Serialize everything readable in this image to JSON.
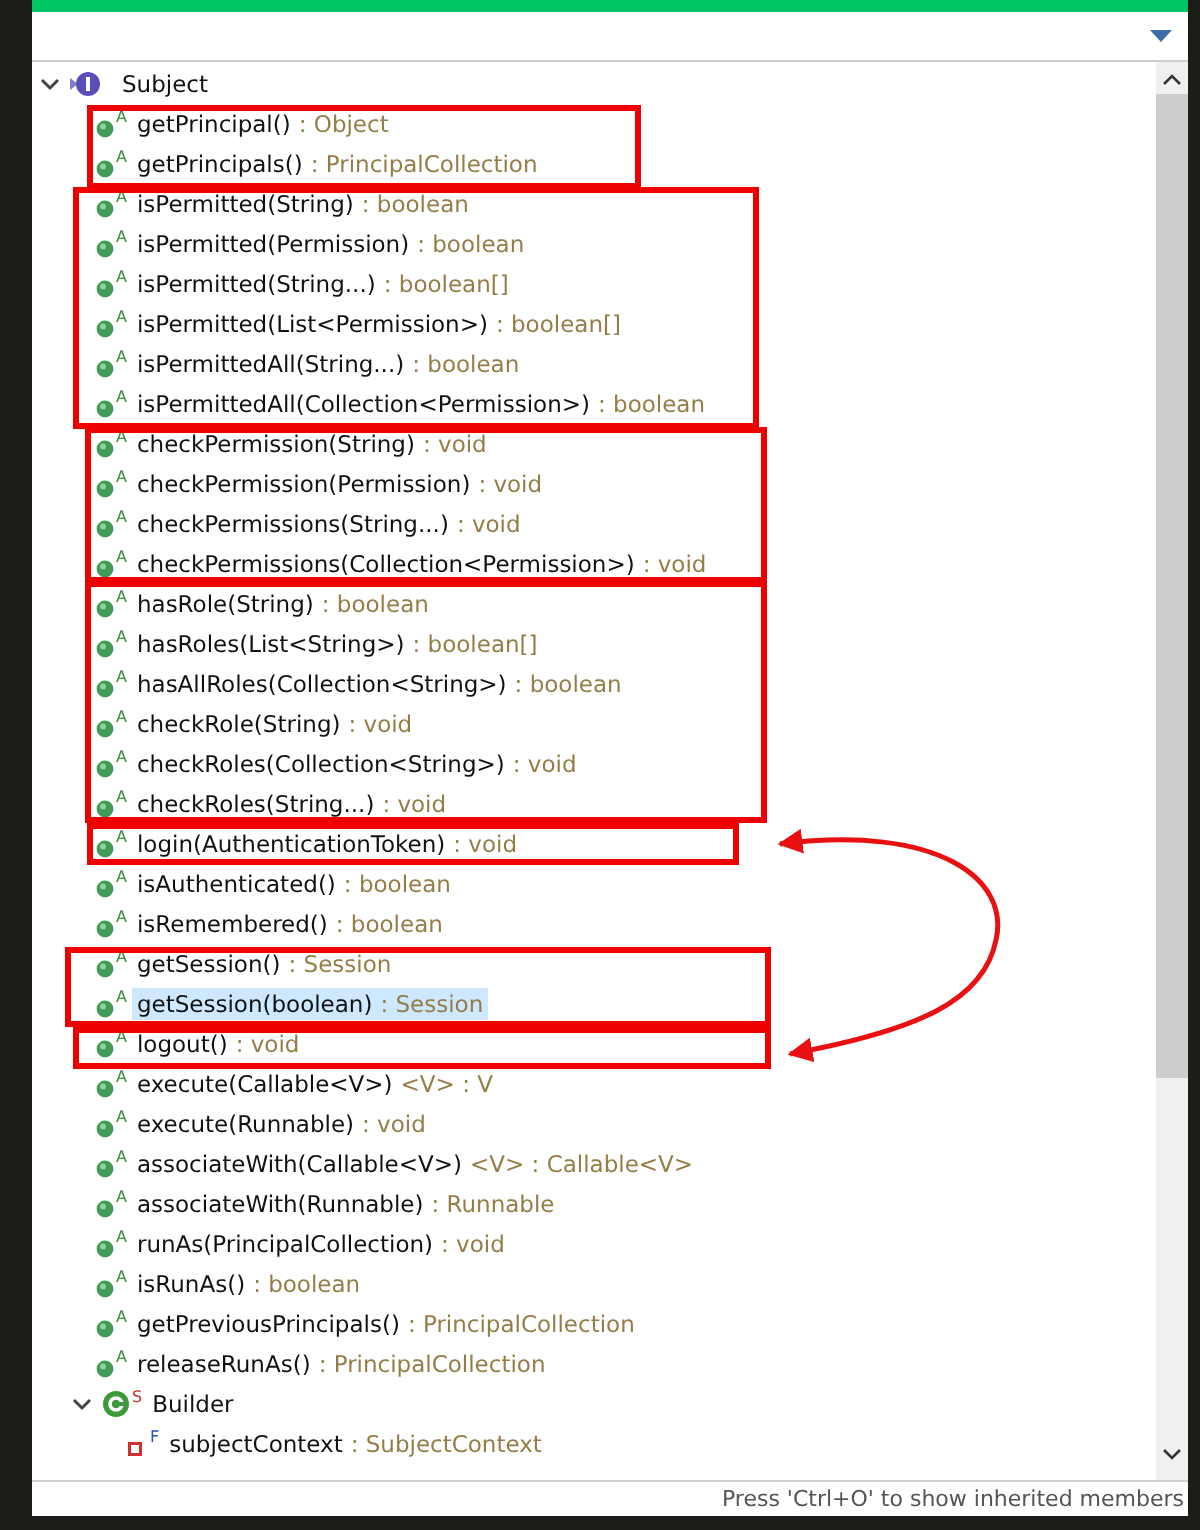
{
  "tree": [
    {
      "kind": "interface",
      "name": "Subject",
      "expanded": true,
      "children": [
        {
          "kind": "method",
          "modifier": "A",
          "name": "getPrincipal()",
          "detail": ": Object",
          "selected": false
        },
        {
          "kind": "method",
          "modifier": "A",
          "name": "getPrincipals()",
          "detail": ": PrincipalCollection",
          "selected": false
        },
        {
          "kind": "method",
          "modifier": "A",
          "name": "isPermitted(String)",
          "detail": ": boolean",
          "selected": false
        },
        {
          "kind": "method",
          "modifier": "A",
          "name": "isPermitted(Permission)",
          "detail": ": boolean",
          "selected": false
        },
        {
          "kind": "method",
          "modifier": "A",
          "name": "isPermitted(String...)",
          "detail": ": boolean[]",
          "selected": false
        },
        {
          "kind": "method",
          "modifier": "A",
          "name": "isPermitted(List<Permission>)",
          "detail": ": boolean[]",
          "selected": false
        },
        {
          "kind": "method",
          "modifier": "A",
          "name": "isPermittedAll(String...)",
          "detail": ": boolean",
          "selected": false
        },
        {
          "kind": "method",
          "modifier": "A",
          "name": "isPermittedAll(Collection<Permission>)",
          "detail": ": boolean",
          "selected": false
        },
        {
          "kind": "method",
          "modifier": "A",
          "name": "checkPermission(String)",
          "detail": ": void",
          "selected": false
        },
        {
          "kind": "method",
          "modifier": "A",
          "name": "checkPermission(Permission)",
          "detail": ": void",
          "selected": false
        },
        {
          "kind": "method",
          "modifier": "A",
          "name": "checkPermissions(String...)",
          "detail": ": void",
          "selected": false
        },
        {
          "kind": "method",
          "modifier": "A",
          "name": "checkPermissions(Collection<Permission>)",
          "detail": ": void",
          "selected": false
        },
        {
          "kind": "method",
          "modifier": "A",
          "name": "hasRole(String)",
          "detail": ": boolean",
          "selected": false
        },
        {
          "kind": "method",
          "modifier": "A",
          "name": "hasRoles(List<String>)",
          "detail": ": boolean[]",
          "selected": false
        },
        {
          "kind": "method",
          "modifier": "A",
          "name": "hasAllRoles(Collection<String>)",
          "detail": ": boolean",
          "selected": false
        },
        {
          "kind": "method",
          "modifier": "A",
          "name": "checkRole(String)",
          "detail": ": void",
          "selected": false
        },
        {
          "kind": "method",
          "modifier": "A",
          "name": "checkRoles(Collection<String>)",
          "detail": ": void",
          "selected": false
        },
        {
          "kind": "method",
          "modifier": "A",
          "name": "checkRoles(String...)",
          "detail": ": void",
          "selected": false
        },
        {
          "kind": "method",
          "modifier": "A",
          "name": "login(AuthenticationToken)",
          "detail": ": void",
          "selected": false
        },
        {
          "kind": "method",
          "modifier": "A",
          "name": "isAuthenticated()",
          "detail": ": boolean",
          "selected": false
        },
        {
          "kind": "method",
          "modifier": "A",
          "name": "isRemembered()",
          "detail": ": boolean",
          "selected": false
        },
        {
          "kind": "method",
          "modifier": "A",
          "name": "getSession()",
          "detail": ": Session",
          "selected": false
        },
        {
          "kind": "method",
          "modifier": "A",
          "name": "getSession(boolean)",
          "detail": ": Session",
          "selected": true
        },
        {
          "kind": "method",
          "modifier": "A",
          "name": "logout()",
          "detail": ": void",
          "selected": false
        },
        {
          "kind": "method",
          "modifier": "A",
          "name": "execute(Callable<V>)",
          "detail": "<V> : V",
          "selected": false
        },
        {
          "kind": "method",
          "modifier": "A",
          "name": "execute(Runnable)",
          "detail": ": void",
          "selected": false
        },
        {
          "kind": "method",
          "modifier": "A",
          "name": "associateWith(Callable<V>)",
          "detail": "<V> : Callable<V>",
          "selected": false
        },
        {
          "kind": "method",
          "modifier": "A",
          "name": "associateWith(Runnable)",
          "detail": ": Runnable",
          "selected": false
        },
        {
          "kind": "method",
          "modifier": "A",
          "name": "runAs(PrincipalCollection)",
          "detail": ": void",
          "selected": false
        },
        {
          "kind": "method",
          "modifier": "A",
          "name": "isRunAs()",
          "detail": ": boolean",
          "selected": false
        },
        {
          "kind": "method",
          "modifier": "A",
          "name": "getPreviousPrincipals()",
          "detail": ": PrincipalCollection",
          "selected": false
        },
        {
          "kind": "method",
          "modifier": "A",
          "name": "releaseRunAs()",
          "detail": ": PrincipalCollection",
          "selected": false
        },
        {
          "kind": "class",
          "modifier": "S",
          "name": "Builder",
          "expanded": true,
          "children": [
            {
              "kind": "field",
              "modifier": "F",
              "name": "subjectContext",
              "detail": ": SubjectContext",
              "selected": false
            }
          ]
        }
      ]
    }
  ],
  "status_bar": "Press 'Ctrl+O' to show inherited members"
}
